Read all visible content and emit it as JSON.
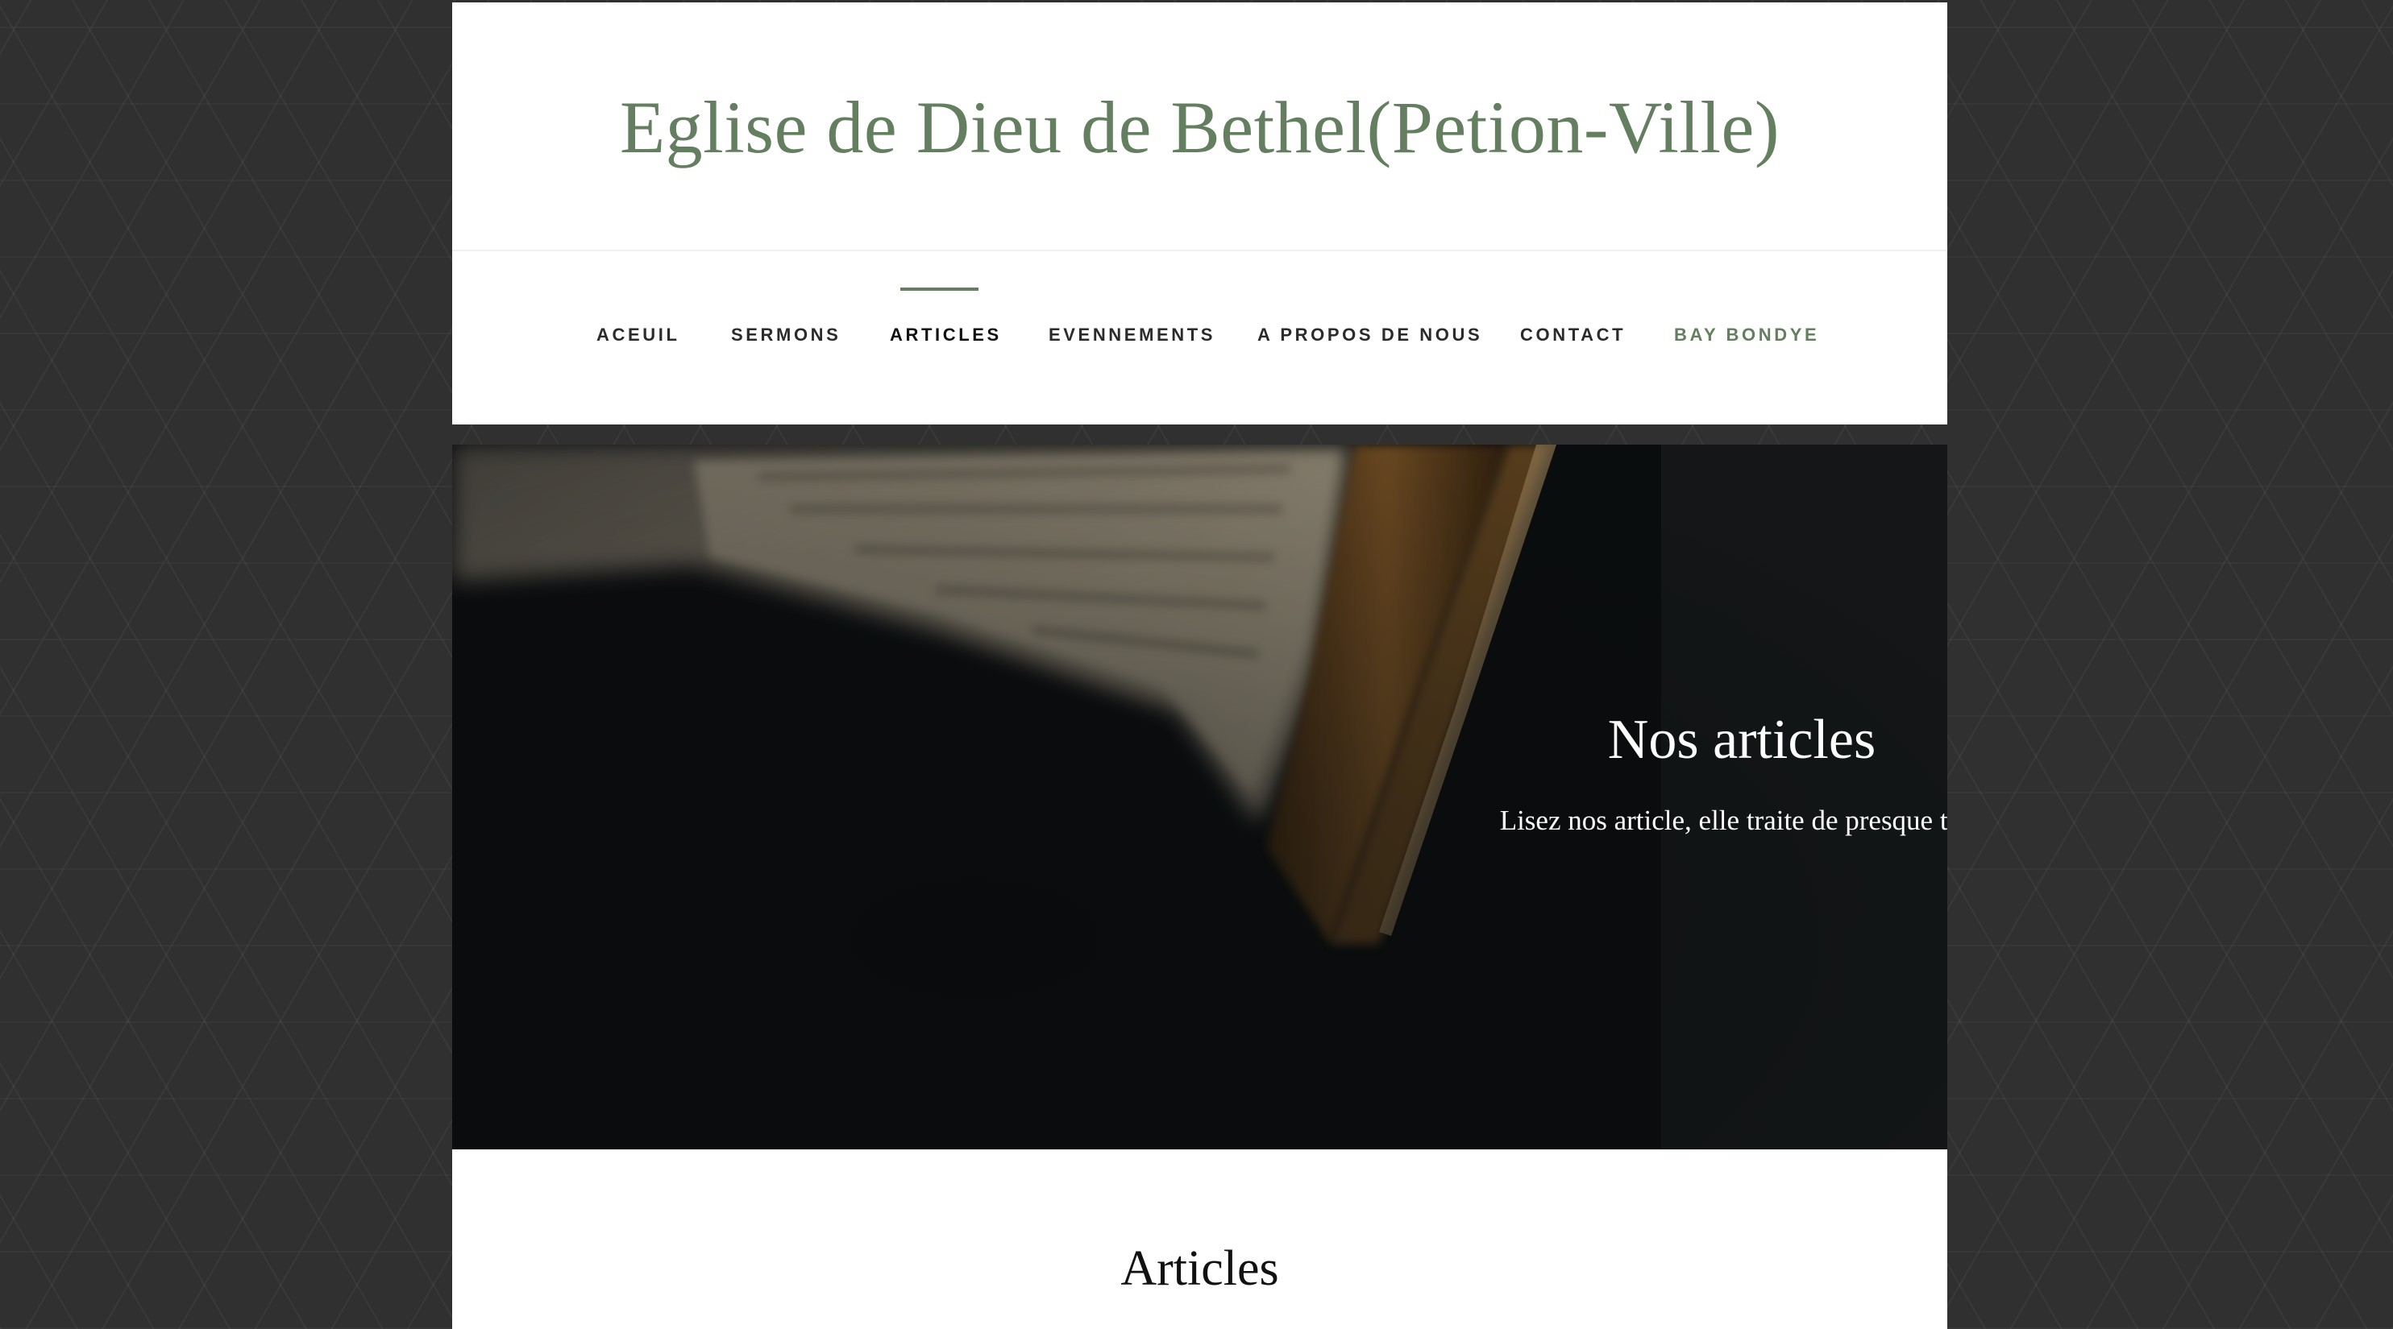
{
  "site": {
    "title": "Eglise de Dieu de Bethel(Petion-Ville)"
  },
  "nav": {
    "items": [
      {
        "label": "ACEUIL"
      },
      {
        "label": "SERMONS"
      },
      {
        "label": "ARTICLES",
        "active": true
      },
      {
        "label": "EVENNEMENTS"
      },
      {
        "label": "A PROPOS DE NOUS"
      },
      {
        "label": "CONTACT"
      },
      {
        "label": "BAY BONDYE"
      }
    ]
  },
  "hero": {
    "title": "Nos articles",
    "subtitle": "Lisez nos article, elle traite de presque tout"
  },
  "content": {
    "section_title": "Articles"
  },
  "colors": {
    "accent": "#647f5f",
    "background": "#303030",
    "hero_dark": "#0e1113"
  }
}
